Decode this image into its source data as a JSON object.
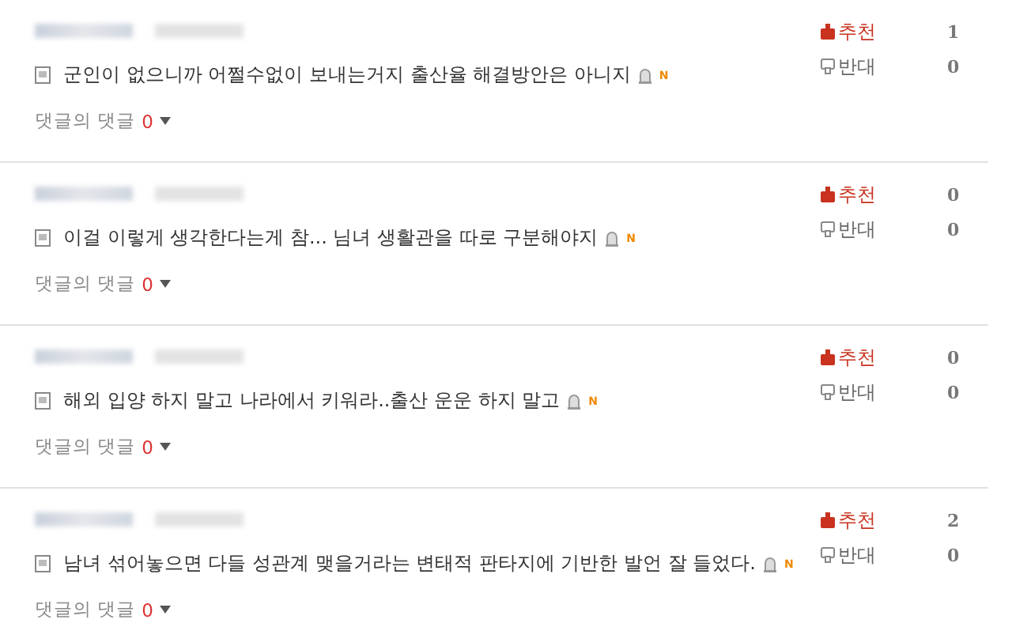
{
  "comments": [
    {
      "text": "군인이 없으니까 어쩔수없이 보내는거지 출산율 해결방안은 아니지",
      "new_mark": "N",
      "reply_label": "댓글의 댓글",
      "reply_count": "0",
      "upvote_label": "추천",
      "upvote_count": "1",
      "downvote_label": "반대",
      "downvote_count": "0"
    },
    {
      "text": "이걸 이렇게 생각한다는게 참... 님녀 생활관을 따로 구분해야지",
      "new_mark": "N",
      "reply_label": "댓글의 댓글",
      "reply_count": "0",
      "upvote_label": "추천",
      "upvote_count": "0",
      "downvote_label": "반대",
      "downvote_count": "0"
    },
    {
      "text": "해외 입양 하지 말고 나라에서 키워라..출산 운운 하지 말고",
      "new_mark": "N",
      "reply_label": "댓글의 댓글",
      "reply_count": "0",
      "upvote_label": "추천",
      "upvote_count": "0",
      "downvote_label": "반대",
      "downvote_count": "0"
    },
    {
      "text": "남녀 섞어놓으면 다들 성관계 맺을거라는 변태적 판타지에 기반한 발언 잘 들었다.",
      "new_mark": "N",
      "reply_label": "댓글의 댓글",
      "reply_count": "0",
      "upvote_label": "추천",
      "upvote_count": "2",
      "downvote_label": "반대",
      "downvote_count": "0"
    }
  ]
}
